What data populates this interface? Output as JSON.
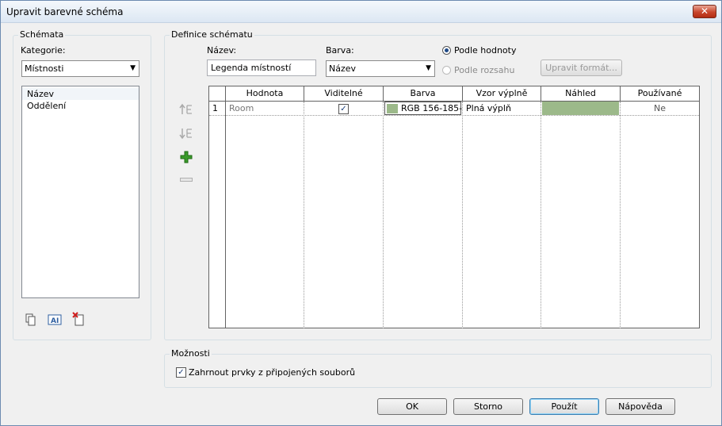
{
  "window": {
    "title": "Upravit barevné schéma",
    "close_glyph": "✕"
  },
  "schemes": {
    "group_title": "Schémata",
    "category_label": "Kategorie:",
    "category_value": "Místnosti",
    "items": [
      "Název",
      "Oddělení"
    ],
    "selected_index": 0
  },
  "definition": {
    "group_title": "Definice schématu",
    "name_label": "Název:",
    "name_value": "Legenda místností",
    "color_label": "Barva:",
    "color_value": "Název",
    "radio_by_value": "Podle hodnoty",
    "radio_by_range": "Podle rozsahu",
    "format_button": "Upravit formát..."
  },
  "table": {
    "columns": [
      "Hodnota",
      "Viditelné",
      "Barva",
      "Vzor výplně",
      "Náhled",
      "Používané"
    ],
    "rows": [
      {
        "num": "1",
        "value": "Room",
        "visible": true,
        "color_text": "RGB 156-185-",
        "swatch": "#9cb98a",
        "pattern": "Plná výplň",
        "used": "Ne"
      }
    ]
  },
  "side_icons": [
    "move-up-icon",
    "move-down-icon",
    "add-icon",
    "remove-icon"
  ],
  "scheme_icons": [
    "duplicate-icon",
    "rename-icon",
    "delete-icon"
  ],
  "options": {
    "group_title": "Možnosti",
    "include_linked": "Zahrnout prvky z připojených souborů",
    "include_linked_checked": true
  },
  "buttons": {
    "ok": "OK",
    "cancel": "Storno",
    "apply": "Použít",
    "help": "Nápověda"
  },
  "colors": {
    "swatch": "#9cb98a",
    "add_icon": "#3a9a2a",
    "title_bar": "#dce7f3"
  }
}
